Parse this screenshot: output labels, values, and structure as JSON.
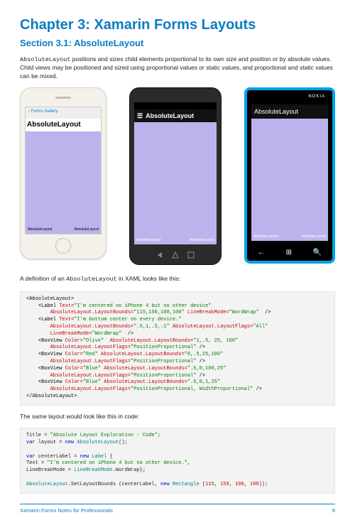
{
  "chapter_title": "Chapter 3: Xamarin Forms Layouts",
  "section_title": "Section 3.1: AbsoluteLayout",
  "intro_para": "AbsoluteLayout positions and sizes child elements proportional to its own size and position or by absolute values. Child views may be positioned and sized using proportional values or static values, and proportional and static values can be mixed.",
  "phones": {
    "ios": {
      "back_link": "‹ Forms Gallery",
      "heading": "AbsoluteLayout",
      "bottom_left": "AbsoluteLayout",
      "bottom_right": "AbsoluteLayout"
    },
    "android": {
      "titlebar": "AbsoluteLayout",
      "bottom_left": "AbsoluteLayout",
      "bottom_right": "AbsoluteLayout"
    },
    "windows": {
      "brand": "NOKIA",
      "titlebar": "AbsoluteLayout",
      "bottom_left": "AbsoluteLayout",
      "bottom_right": "AbsoluteLayout"
    }
  },
  "caption_before_xaml": "A definition of an AbsoluteLayout in XAML looks like this:",
  "xaml": {
    "open": "<AbsoluteLayout>",
    "label1": {
      "tag": "<Label",
      "attr1_name": " Text=",
      "attr1_val": "\"I'm centered on iPhone 4 but no other device\"",
      "attr2_name": "        AbsoluteLayout.LayoutBounds=",
      "attr2_val": "\"115,150,100,100\"",
      "attr3_name": " LineBreakMode=",
      "attr3_val": "\"WordWrap\"",
      "close": "  />"
    },
    "label2": {
      "tag": "    <Label",
      "attr1_name": " Text=",
      "attr1_val": "\"I'm bottom center on every device.\"",
      "attr2_name": "        AbsoluteLayout.LayoutBounds=",
      "attr2_val": "\".5,1,.5,.1\"",
      "attr3_name": " AbsoluteLayout.LayoutFlags=",
      "attr3_val": "\"All\"",
      "attr4_name": "        LineBreakMode=",
      "attr4_val": "\"WordWrap\"",
      "close": "  />"
    },
    "box1": {
      "tag": "    <BoxView",
      "c_name": " Color=",
      "c_val": "\"Olive\"",
      "b_name": "  AbsoluteLayout.LayoutBounds=",
      "b_val": "\"1,.5, 25, 100\"",
      "f_name": "        AbsoluteLayout.LayoutFlags=",
      "f_val": "\"PositionProportional\"",
      "close": " />"
    },
    "box2": {
      "tag": "    <BoxView",
      "c_name": " Color=",
      "c_val": "\"Red\"",
      "b_name": " AbsoluteLayout.LayoutBounds=",
      "b_val": "\"0,.5,25,100\"",
      "f_name": "        AbsoluteLayout.LayoutFlags=",
      "f_val": "\"PositionProportional\"",
      "close": " />"
    },
    "box3": {
      "tag": "    <BoxView",
      "c_name": " Color=",
      "c_val": "\"Blue\"",
      "b_name": " AbsoluteLayout.LayoutBounds=",
      "b_val": "\".5,0,100,25\"",
      "f_name": "        AbsoluteLayout.LayoutFlags=",
      "f_val": "\"PositionProportional\"",
      "close": " />"
    },
    "box4": {
      "tag": "    <BoxView",
      "c_name": " Color=",
      "c_val": "\"Blue\"",
      "b_name": " AbsoluteLayout.LayoutBounds=",
      "b_val": "\".5,0,1,25\"",
      "f_name": "        AbsoluteLayout.LayoutFlags=",
      "f_val": "\"PositionProportional, WidthProportional\"",
      "close": " />"
    },
    "close": "</AbsoluteLayout>"
  },
  "caption_before_code": "The same layout would look like this in code:",
  "csharp": {
    "l1a": "Title = ",
    "l1b": "\"Absolute Layout Exploration - Code\"",
    "l1c": ";",
    "l2a": "var",
    "l2b": " layout = ",
    "l2c": "new",
    "l2d": " AbsoluteLayout",
    "l2e": "();",
    "l3a": "var",
    "l3b": " centerLabel = ",
    "l3c": "new",
    "l3d": " Label",
    "l3e": " {",
    "l4a": "Text = ",
    "l4b": "\"I'm centered on iPhone 4 but no other device.\"",
    "l4c": ",",
    "l5a": "LineBreakMode = ",
    "l5b": "LineBreakMode",
    "l5c": ".WordWrap};",
    "l6a": "AbsoluteLayout",
    "l6b": ".SetLayoutBounds (centerLabel, ",
    "l6c": "new",
    "l6d": " Rectangle",
    "l6e": " (",
    "l6f": "115",
    "l6g": ", ",
    "l6h": "159",
    "l6i": ", ",
    "l6j": "100",
    "l6k": ", ",
    "l6l": "100",
    "l6m": "));"
  },
  "footer_left": "Xamarin.Forms Notes for Professionals",
  "footer_right": "8"
}
